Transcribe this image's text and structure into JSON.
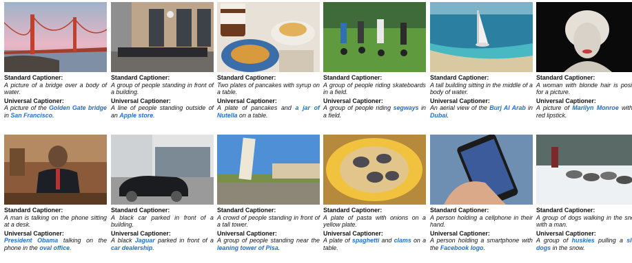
{
  "items": [
    {
      "image": "golden-gate-bridge-photo",
      "std_label": "Standard Captioner:",
      "std_text": "A picture of a bridge over a body of water.",
      "uni_label": "Universal Captioner:",
      "uni": [
        {
          "t": "A picture of the ",
          "h": false
        },
        {
          "t": "Golden Gate bridge",
          "h": true
        },
        {
          "t": " in ",
          "h": false
        },
        {
          "t": "San Francisco",
          "h": true
        },
        {
          "t": ".",
          "h": false
        }
      ]
    },
    {
      "image": "apple-store-crowd-photo",
      "std_label": "Standard Captioner:",
      "std_text": "A group of people standing in front of a building.",
      "uni_label": "Universal Captioner:",
      "uni": [
        {
          "t": "A line of people standing outside of an ",
          "h": false
        },
        {
          "t": "Apple store",
          "h": true
        },
        {
          "t": ".",
          "h": false
        }
      ]
    },
    {
      "image": "pancakes-nutella-photo",
      "std_label": "Standard Captioner:",
      "std_text": "Two plates of pancakes with syrup on a table.",
      "uni_label": "Universal Captioner:",
      "uni": [
        {
          "t": "A plate of pancakes and ",
          "h": false
        },
        {
          "t": "a jar of Nutella",
          "h": true
        },
        {
          "t": " on a table.",
          "h": false
        }
      ]
    },
    {
      "image": "segway-riders-photo",
      "std_label": "Standard Captioner:",
      "std_text": "A group of people riding skateboards in a field.",
      "uni_label": "Universal Captioner:",
      "uni": [
        {
          "t": "A group of people riding ",
          "h": false
        },
        {
          "t": "segways",
          "h": true
        },
        {
          "t": " in a field.",
          "h": false
        }
      ]
    },
    {
      "image": "burj-al-arab-aerial-photo",
      "std_label": "Standard Captioner:",
      "std_text": "A tall building sitting in the middle of a body of water.",
      "uni_label": "Universal Captioner:",
      "uni": [
        {
          "t": "An aerial view of the ",
          "h": false
        },
        {
          "t": "Burj Al Arab",
          "h": true
        },
        {
          "t": " in ",
          "h": false
        },
        {
          "t": "Dubai",
          "h": true
        },
        {
          "t": ".",
          "h": false
        }
      ]
    },
    {
      "image": "marilyn-monroe-portrait-photo",
      "std_label": "Standard Captioner:",
      "std_text": "A woman with blonde hair is posing for a picture.",
      "uni_label": "Universal Captioner:",
      "uni": [
        {
          "t": "A picture of ",
          "h": false
        },
        {
          "t": "Marilyn Monroe",
          "h": true
        },
        {
          "t": " with a red lipstick.",
          "h": false
        }
      ]
    },
    {
      "image": "obama-phone-desk-photo",
      "std_label": "Standard Captioner:",
      "std_text": "A man is talking on the phone sitting at a desk.",
      "uni_label": "Universal Captioner:",
      "uni": [
        {
          "t": "President Obama",
          "h": true
        },
        {
          "t": " talking on the phone in the ",
          "h": false
        },
        {
          "t": "oval office",
          "h": true
        },
        {
          "t": ".",
          "h": false
        }
      ]
    },
    {
      "image": "jaguar-dealership-photo",
      "std_label": "Standard Captioner:",
      "std_text": "A black car parked in front of a building.",
      "uni_label": "Universal Captioner:",
      "uni": [
        {
          "t": "A black ",
          "h": false
        },
        {
          "t": "Jaguar",
          "h": true
        },
        {
          "t": " parked in front of a ",
          "h": false
        },
        {
          "t": "car dealership",
          "h": true
        },
        {
          "t": ".",
          "h": false
        }
      ]
    },
    {
      "image": "leaning-tower-pisa-photo",
      "std_label": "Standard Captioner:",
      "std_text": "A crowd of people standing in front of a tall tower.",
      "uni_label": "Universal Captioner:",
      "uni": [
        {
          "t": "A group of people standing near the ",
          "h": false
        },
        {
          "t": "leaning tower of Pisa",
          "h": true
        },
        {
          "t": ".",
          "h": false
        }
      ]
    },
    {
      "image": "spaghetti-clams-photo",
      "std_label": "Standard Captioner:",
      "std_text": "A plate of pasta with onions on a yellow plate.",
      "uni_label": "Universal Captioner:",
      "uni": [
        {
          "t": "A plate of ",
          "h": false
        },
        {
          "t": "spaghetti",
          "h": true
        },
        {
          "t": " and ",
          "h": false
        },
        {
          "t": "clams",
          "h": true
        },
        {
          "t": " on a table.",
          "h": false
        }
      ]
    },
    {
      "image": "facebook-smartphone-photo",
      "std_label": "Standard Captioner:",
      "std_text": "A person holding a cellphone in their hand.",
      "uni_label": "Universal Captioner:",
      "uni": [
        {
          "t": "A person holding a smartphone with the ",
          "h": false
        },
        {
          "t": "Facebook logo",
          "h": true
        },
        {
          "t": ".",
          "h": false
        }
      ]
    },
    {
      "image": "husky-sled-dogs-photo",
      "std_label": "Standard Captioner:",
      "std_text": "A group of dogs walking in the snow with a man.",
      "uni_label": "Universal Captioner:",
      "uni": [
        {
          "t": "A group of ",
          "h": false
        },
        {
          "t": "huskies",
          "h": true
        },
        {
          "t": " pulling a ",
          "h": false
        },
        {
          "t": "sled dogs",
          "h": true
        },
        {
          "t": " in the snow.",
          "h": false
        }
      ]
    }
  ]
}
